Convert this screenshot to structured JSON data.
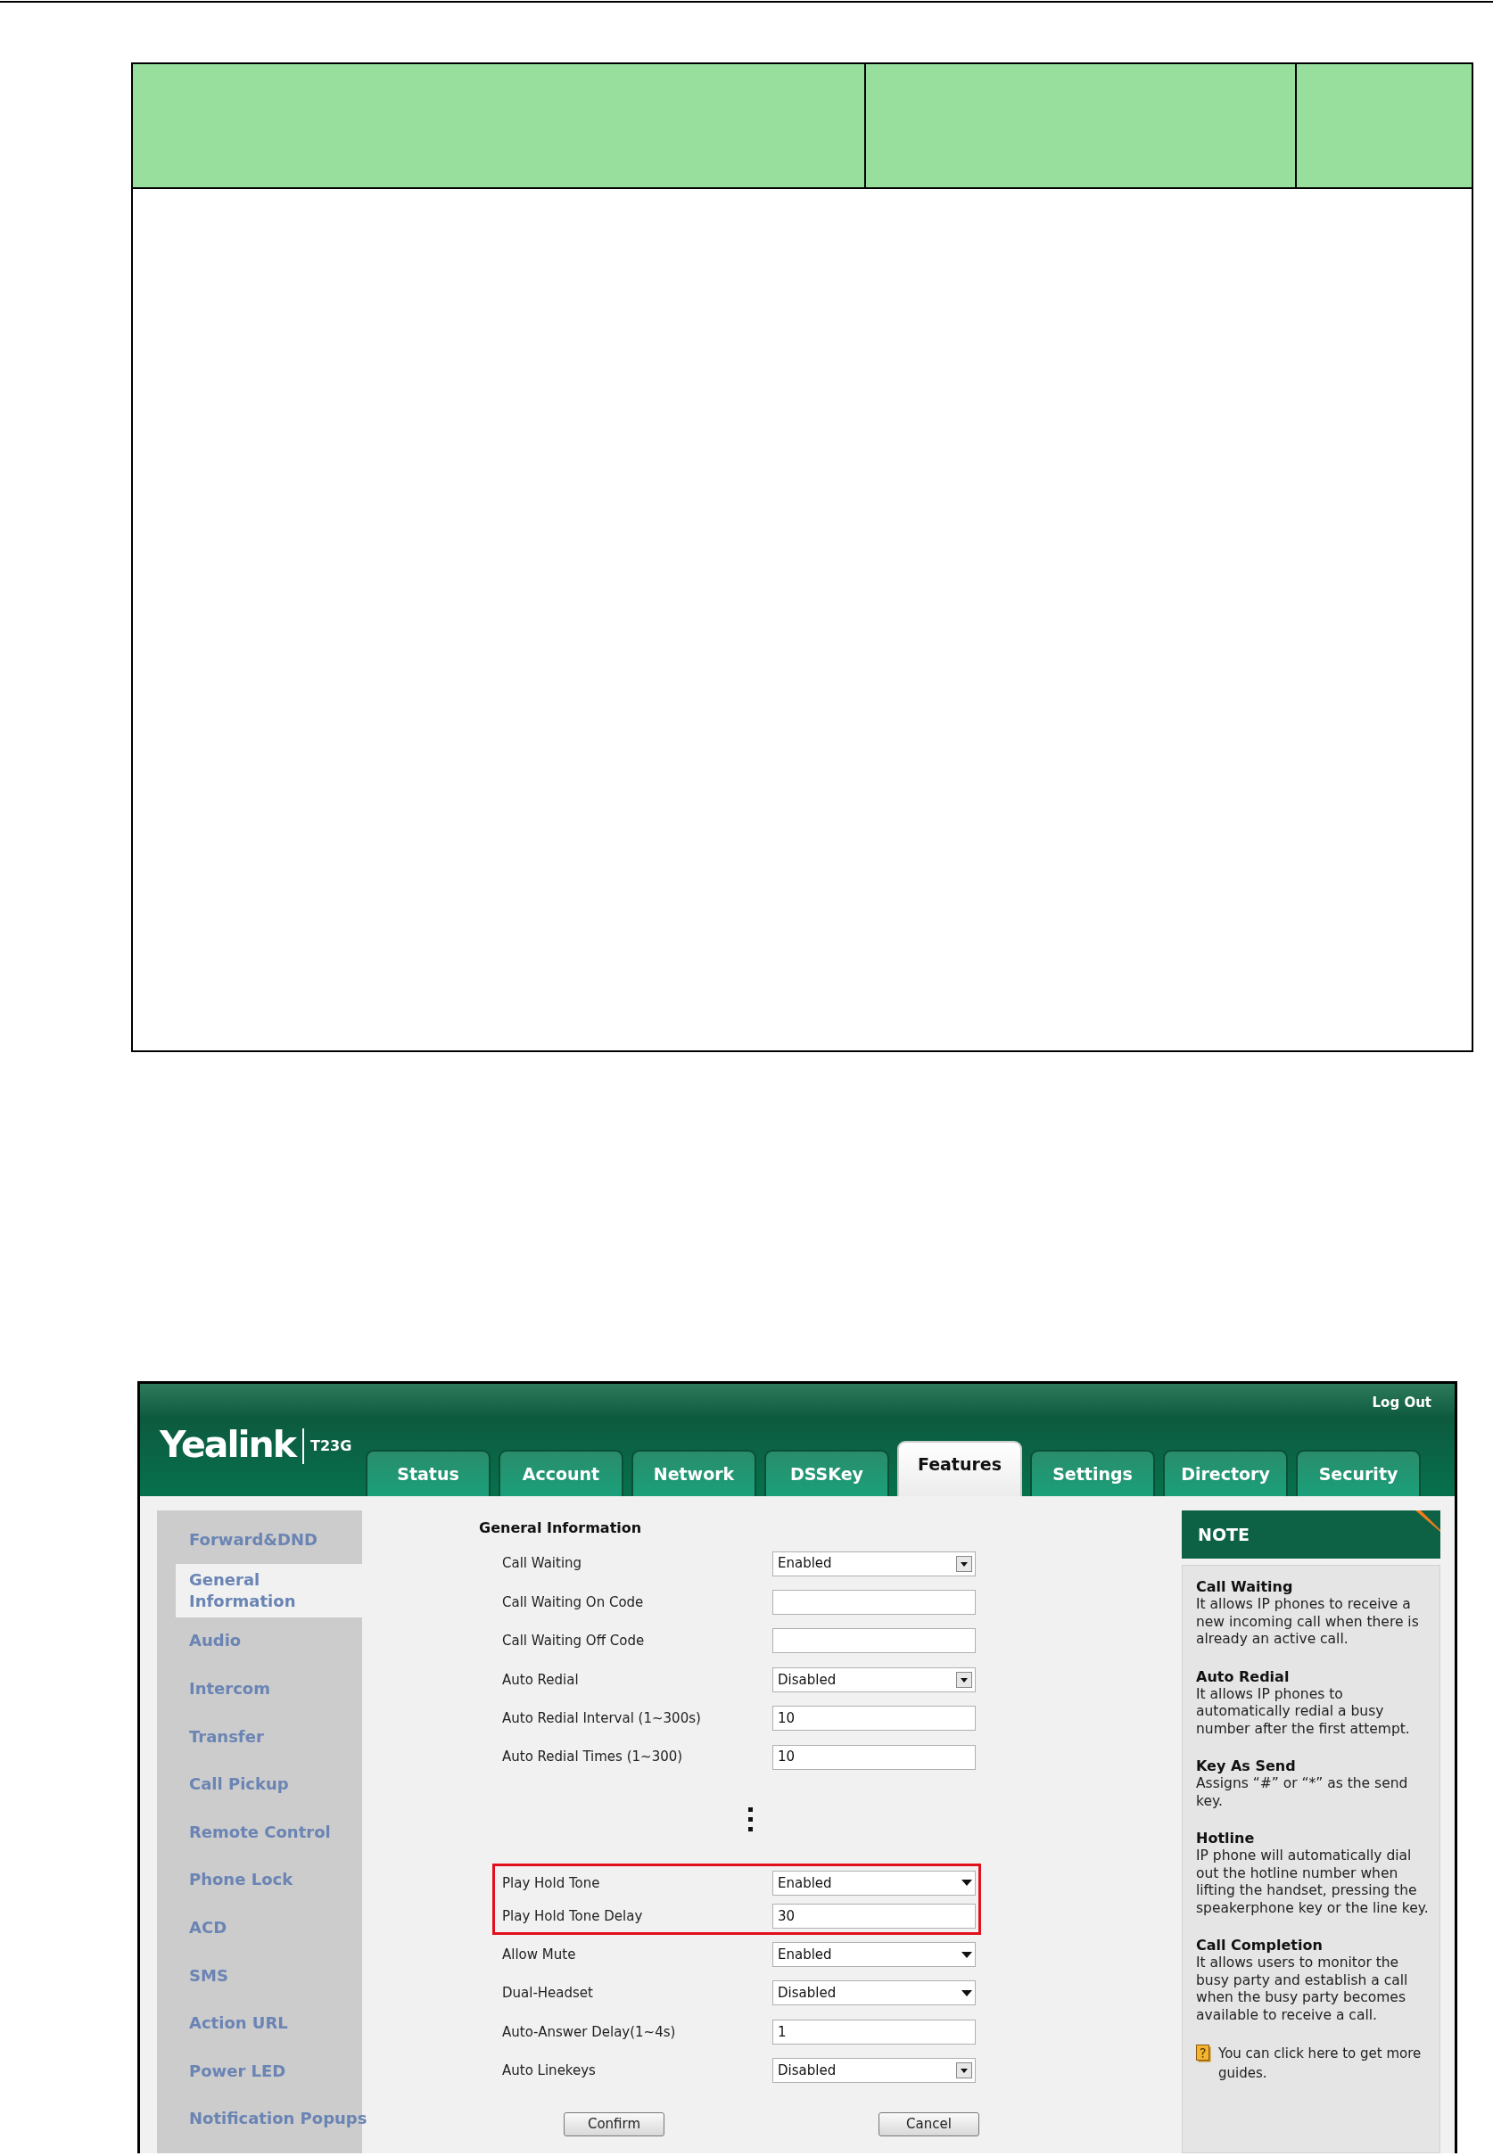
{
  "header": {
    "logo": "Yealink",
    "model": "T23G",
    "logout": "Log Out"
  },
  "tabs": [
    {
      "label": "Status",
      "selected": false
    },
    {
      "label": "Account",
      "selected": false
    },
    {
      "label": "Network",
      "selected": false
    },
    {
      "label": "DSSKey",
      "selected": false
    },
    {
      "label": "Features",
      "selected": true
    },
    {
      "label": "Settings",
      "selected": false
    },
    {
      "label": "Directory",
      "selected": false
    },
    {
      "label": "Security",
      "selected": false
    }
  ],
  "sidebar": {
    "items": [
      {
        "label": "Forward&DND",
        "selected": false
      },
      {
        "label": "General Information",
        "selected": true
      },
      {
        "label": "Audio",
        "selected": false
      },
      {
        "label": "Intercom",
        "selected": false
      },
      {
        "label": "Transfer",
        "selected": false
      },
      {
        "label": "Call Pickup",
        "selected": false
      },
      {
        "label": "Remote Control",
        "selected": false
      },
      {
        "label": "Phone Lock",
        "selected": false
      },
      {
        "label": "ACD",
        "selected": false
      },
      {
        "label": "SMS",
        "selected": false
      },
      {
        "label": "Action URL",
        "selected": false
      },
      {
        "label": "Power LED",
        "selected": false
      },
      {
        "label": "Notification Popups",
        "selected": false
      }
    ]
  },
  "form": {
    "title": "General Information",
    "rows": [
      {
        "kind": "dropdown-boxed",
        "label": "Call Waiting",
        "value": "Enabled",
        "highlighted": false
      },
      {
        "kind": "text",
        "label": "Call Waiting On Code",
        "highlighted": false
      },
      {
        "kind": "text",
        "label": "Call Waiting Off Code",
        "highlighted": false
      },
      {
        "kind": "dropdown-boxed",
        "label": "Auto Redial",
        "value": "Disabled",
        "highlighted": false
      },
      {
        "kind": "text",
        "label": "Auto Redial Interval (1~300s)",
        "value": "10",
        "highlighted": false
      },
      {
        "kind": "text",
        "label": "Auto Redial Times (1~300)",
        "value": "10",
        "highlighted": false
      },
      {
        "kind": "ellipsis"
      },
      {
        "kind": "dropdown",
        "label": "Play Hold Tone",
        "value": "Enabled",
        "highlighted": true
      },
      {
        "kind": "text",
        "label": "Play Hold Tone Delay",
        "value": "30",
        "highlighted": true
      },
      {
        "kind": "dropdown",
        "label": "Allow Mute",
        "value": "Enabled",
        "highlighted": false
      },
      {
        "kind": "dropdown",
        "label": "Dual-Headset",
        "value": "Disabled",
        "highlighted": false
      },
      {
        "kind": "text",
        "label": "Auto-Answer Delay(1~4s)",
        "value": "1",
        "highlighted": false
      },
      {
        "kind": "dropdown-boxed",
        "label": "Auto Linekeys",
        "value": "Disabled",
        "highlighted": false
      }
    ],
    "buttons": [
      "Confirm",
      "Cancel"
    ]
  },
  "note": {
    "title": "NOTE",
    "entries": [
      {
        "heading": "Call Waiting",
        "text": "It allows IP phones to receive a new incoming call when there is already an active call."
      },
      {
        "heading": "Auto Redial",
        "text": "It allows IP phones to automatically redial a busy number after the first attempt."
      },
      {
        "heading": "Key As Send",
        "text": "Assigns “#” or “*” as the send key."
      },
      {
        "heading": "Hotline",
        "text": "IP phone will automatically dial out the hotline number when lifting the handset, pressing the speakerphone key or the line key."
      },
      {
        "heading": "Call Completion",
        "text": "It allows users to monitor the busy party and establish a call when the busy party becomes available to receive a call."
      }
    ],
    "help": "You can click here to get more guides."
  }
}
